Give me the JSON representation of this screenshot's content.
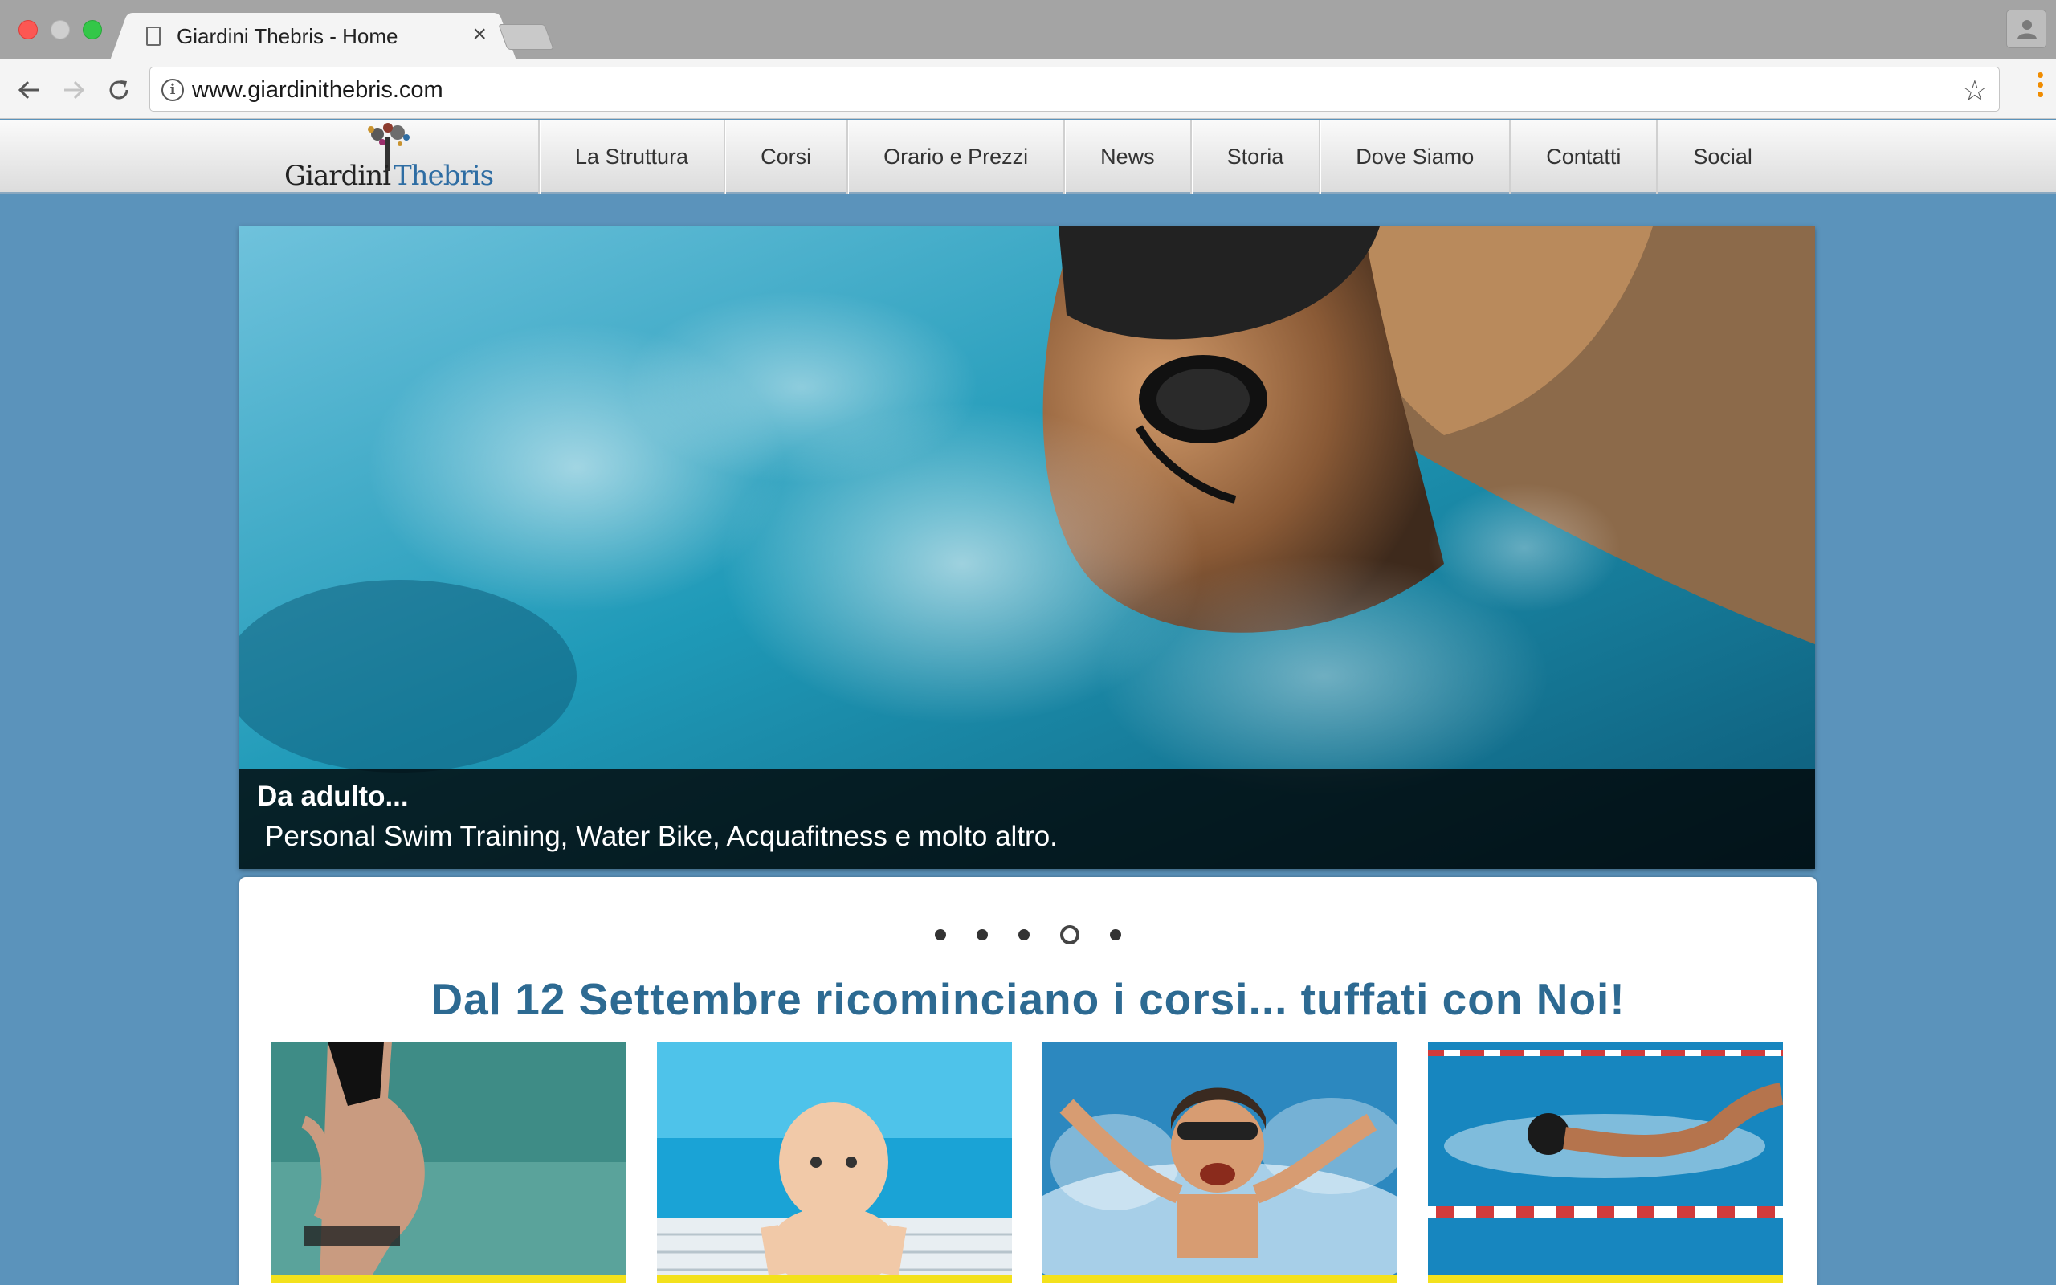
{
  "browser": {
    "tab_title": "Giardini Thebris - Home",
    "url": "www.giardinithebris.com"
  },
  "site": {
    "logo": {
      "word1": "Giardini",
      "word2": "Thebris"
    },
    "nav": [
      {
        "label": "La Struttura"
      },
      {
        "label": "Corsi"
      },
      {
        "label": "Orario e Prezzi"
      },
      {
        "label": "News"
      },
      {
        "label": "Storia"
      },
      {
        "label": "Dove Siamo"
      },
      {
        "label": "Contatti"
      },
      {
        "label": "Social"
      }
    ]
  },
  "slider": {
    "caption_title": "Da adulto...",
    "caption_text": "Personal Swim Training, Water Bike, Acquafitness e molto altro.",
    "slide_count": 5,
    "active_slide": 4
  },
  "headline": "Dal 12 Settembre ricominciano i corsi... tuffati con Noi!",
  "colors": {
    "page_background": "#5b93bb",
    "headline": "#2d6a92",
    "card_bar": "#f3e11c"
  }
}
